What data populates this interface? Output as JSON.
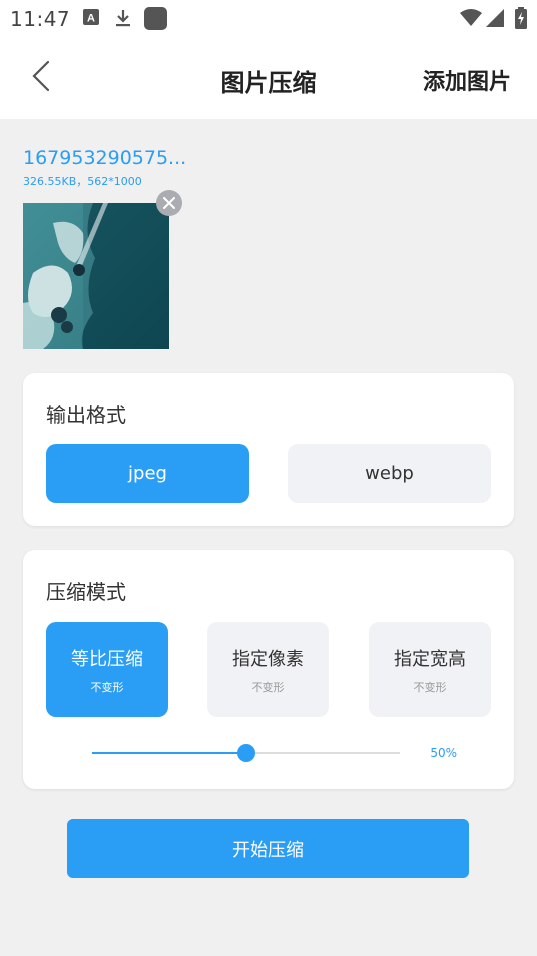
{
  "status_bar": {
    "time": "11:47",
    "icons": [
      "app-a-icon",
      "download-icon",
      "app-square-icon",
      "wifi-icon",
      "signal-icon",
      "battery-charging-icon"
    ]
  },
  "app_bar": {
    "title": "图片压缩",
    "add_label": "添加图片",
    "back_icon": "chevron-left-icon"
  },
  "file": {
    "name": "167953290575...",
    "meta": "326.55KB，562*1000"
  },
  "output_format": {
    "title": "输出格式",
    "options": [
      {
        "label": "jpeg",
        "selected": true
      },
      {
        "label": "webp",
        "selected": false
      }
    ]
  },
  "compress_mode": {
    "title": "压缩模式",
    "options": [
      {
        "label": "等比压缩",
        "sub": "不变形",
        "selected": true
      },
      {
        "label": "指定像素",
        "sub": "不变形",
        "selected": false
      },
      {
        "label": "指定宽高",
        "sub": "不变形",
        "selected": false
      }
    ],
    "slider": {
      "value": 0.5,
      "label": "50%"
    }
  },
  "start_button": {
    "label": "开始压缩"
  },
  "colors": {
    "accent": "#2a9df4",
    "background": "#f0f0f0"
  }
}
